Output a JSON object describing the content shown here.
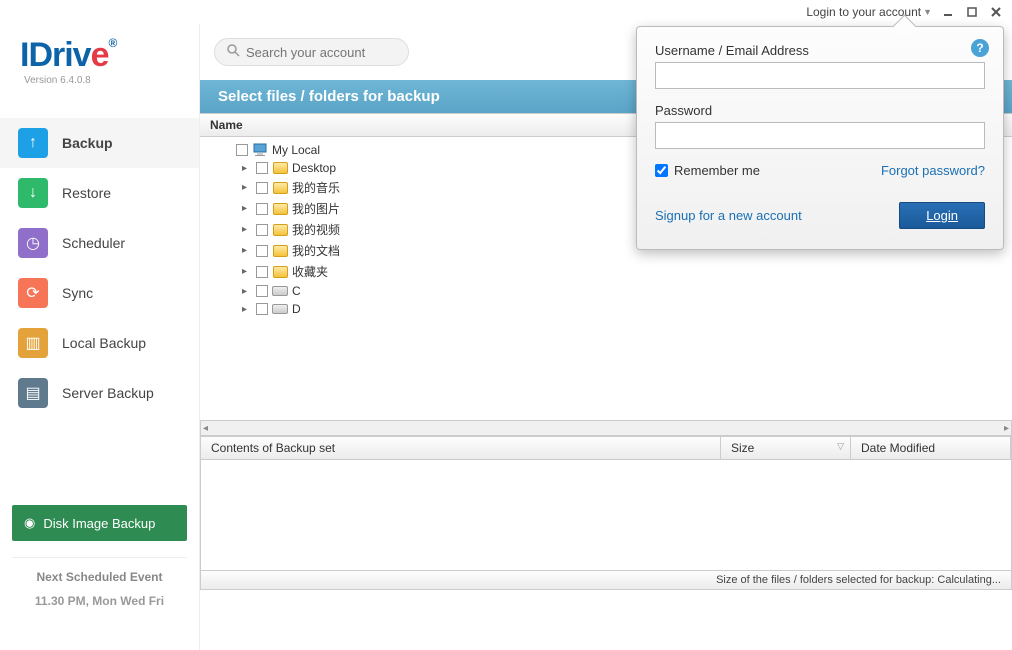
{
  "titlebar": {
    "login_text": "Login to your account"
  },
  "logo": {
    "text1": "IDriv",
    "text2": "e",
    "reg": "®",
    "version": "Version  6.4.0.8"
  },
  "nav": {
    "items": [
      {
        "label": "Backup",
        "color": "#1ea0e6",
        "glyph": "↑"
      },
      {
        "label": "Restore",
        "color": "#2fb96b",
        "glyph": "↓"
      },
      {
        "label": "Scheduler",
        "color": "#8f6fc9",
        "glyph": "◷"
      },
      {
        "label": "Sync",
        "color": "#f67556",
        "glyph": "⟳"
      },
      {
        "label": "Local Backup",
        "color": "#e3a33a",
        "glyph": "▥"
      },
      {
        "label": "Server Backup",
        "color": "#5f7a8c",
        "glyph": "▤"
      }
    ]
  },
  "disk_backup": "Disk Image Backup",
  "schedule": {
    "title": "Next Scheduled Event",
    "time": "11.30 PM, Mon Wed Fri"
  },
  "search": {
    "placeholder": "Search your account"
  },
  "bluebar": "Select files / folders for backup",
  "tree_header": "Name",
  "tree": {
    "root": "My Local",
    "children": [
      {
        "label": "Desktop",
        "type": "folder"
      },
      {
        "label": "我的音乐",
        "type": "folder"
      },
      {
        "label": "我的图片",
        "type": "folder"
      },
      {
        "label": "我的视频",
        "type": "folder"
      },
      {
        "label": "我的文档",
        "type": "folder"
      },
      {
        "label": "收藏夹",
        "type": "folder"
      },
      {
        "label": "C",
        "type": "drive"
      },
      {
        "label": "D",
        "type": "drive"
      }
    ]
  },
  "contents": {
    "header": "Contents of Backup set",
    "size": "Size",
    "date": "Date Modified"
  },
  "status": "Size of the files / folders selected for backup: Calculating...",
  "login": {
    "username_label": "Username / Email Address",
    "password_label": "Password",
    "remember": "Remember me",
    "forgot": "Forgot password?",
    "signup": "Signup for a new account",
    "button": "Login"
  }
}
